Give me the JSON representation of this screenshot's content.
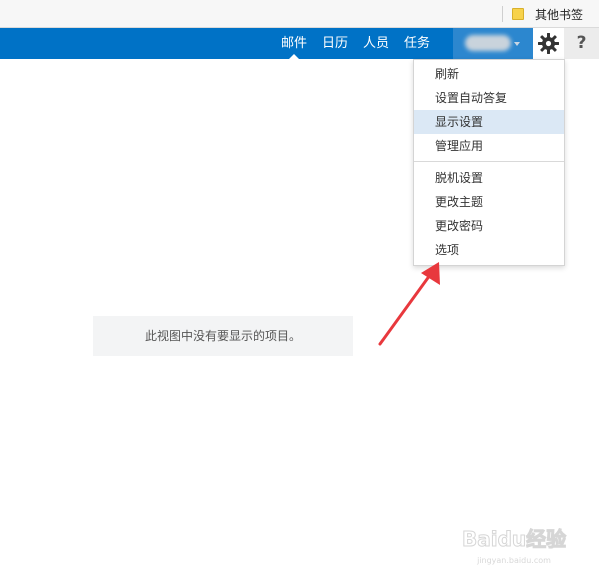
{
  "bookmarks": {
    "folder_icon": "folder-icon",
    "other_label": "其他书签"
  },
  "nav": {
    "tabs": [
      {
        "label": "邮件",
        "active": true
      },
      {
        "label": "日历"
      },
      {
        "label": "人员"
      },
      {
        "label": "任务"
      }
    ],
    "accent": "#0072c6",
    "gear_icon": "gear-icon",
    "help_label": "?"
  },
  "settings_menu": {
    "group1": [
      "刷新",
      "设置自动答复",
      "显示设置",
      "管理应用"
    ],
    "group2": [
      "脱机设置",
      "更改主题",
      "更改密码",
      "选项"
    ],
    "highlighted": "显示设置",
    "highlight_color": "#dbe8f5"
  },
  "main": {
    "empty_message": "此视图中没有要显示的项目。"
  },
  "annotation": {
    "arrow_color": "#e8383d"
  },
  "watermark": {
    "brand": "Baidu经验",
    "site": "jingyan.baidu.com"
  }
}
